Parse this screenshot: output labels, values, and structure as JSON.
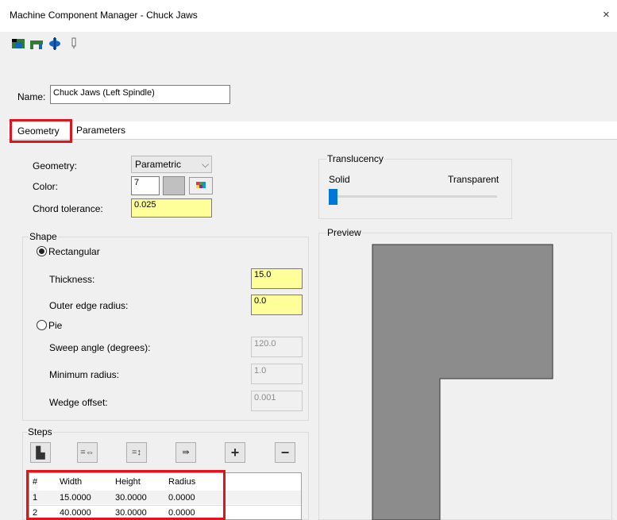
{
  "window": {
    "title": "Machine Component Manager - Chuck Jaws",
    "close_glyph": "×"
  },
  "toolbar": {
    "icons": [
      "stock-icon",
      "chuck-jaws-icon",
      "spindle-icon",
      "tool-icon"
    ]
  },
  "name_field": {
    "label": "Name:",
    "value": "Chuck Jaws (Left Spindle)"
  },
  "tabs": [
    {
      "label": "Geometry",
      "active": true
    },
    {
      "label": "Parameters",
      "active": false
    }
  ],
  "geometry": {
    "geometry_label": "Geometry:",
    "geometry_value": "Parametric",
    "color_label": "Color:",
    "color_value": "7",
    "chord_label": "Chord tolerance:",
    "chord_value": "0.025"
  },
  "translucency": {
    "title": "Translucency",
    "solid": "Solid",
    "transparent": "Transparent",
    "level": 0.0
  },
  "shape": {
    "title": "Shape",
    "rectangular_label": "Rectangular",
    "thickness_label": "Thickness:",
    "thickness_value": "15.0",
    "outer_radius_label": "Outer edge radius:",
    "outer_radius_value": "0.0",
    "pie_label": "Pie",
    "sweep_label": "Sweep angle (degrees):",
    "sweep_value": "120.0",
    "min_radius_label": "Minimum radius:",
    "min_radius_value": "1.0",
    "wedge_label": "Wedge offset:",
    "wedge_value": "0.001"
  },
  "preview": {
    "title": "Preview"
  },
  "steps": {
    "title": "Steps",
    "buttons": [
      "▙",
      "=⇔",
      "=↕",
      "⇛",
      "+",
      "−"
    ],
    "columns": [
      "#",
      "Width",
      "Height",
      "Radius"
    ],
    "rows": [
      [
        "1",
        "15.0000",
        "30.0000",
        "0.0000"
      ],
      [
        "2",
        "40.0000",
        "30.0000",
        "0.0000"
      ]
    ]
  },
  "colors": {
    "highlight": "#e0151b",
    "input_yellow": "#ffff99",
    "preview_fill": "#8c8c8c",
    "accent": "#0078d7"
  }
}
